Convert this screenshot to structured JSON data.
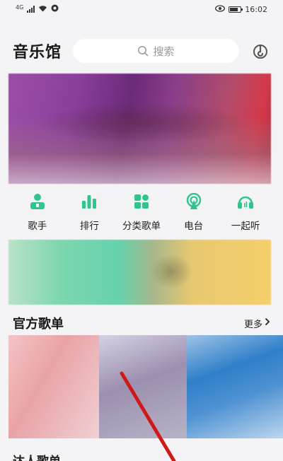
{
  "status_bar": {
    "network": "4G",
    "time": "16:02"
  },
  "header": {
    "title": "音乐馆",
    "search_placeholder": "搜索"
  },
  "quick_nav": [
    {
      "label": "歌手",
      "icon": "singer-icon"
    },
    {
      "label": "排行",
      "icon": "chart-icon"
    },
    {
      "label": "分类歌单",
      "icon": "category-icon"
    },
    {
      "label": "电台",
      "icon": "radio-icon"
    },
    {
      "label": "一起听",
      "icon": "headphones-icon"
    }
  ],
  "official_playlists": {
    "title": "官方歌单",
    "more": "更多"
  },
  "next_section": {
    "title": "达人歌单"
  },
  "colors": {
    "accent": "#2fc58d",
    "background": "#f4f4f6",
    "annotation": "#d01818"
  }
}
